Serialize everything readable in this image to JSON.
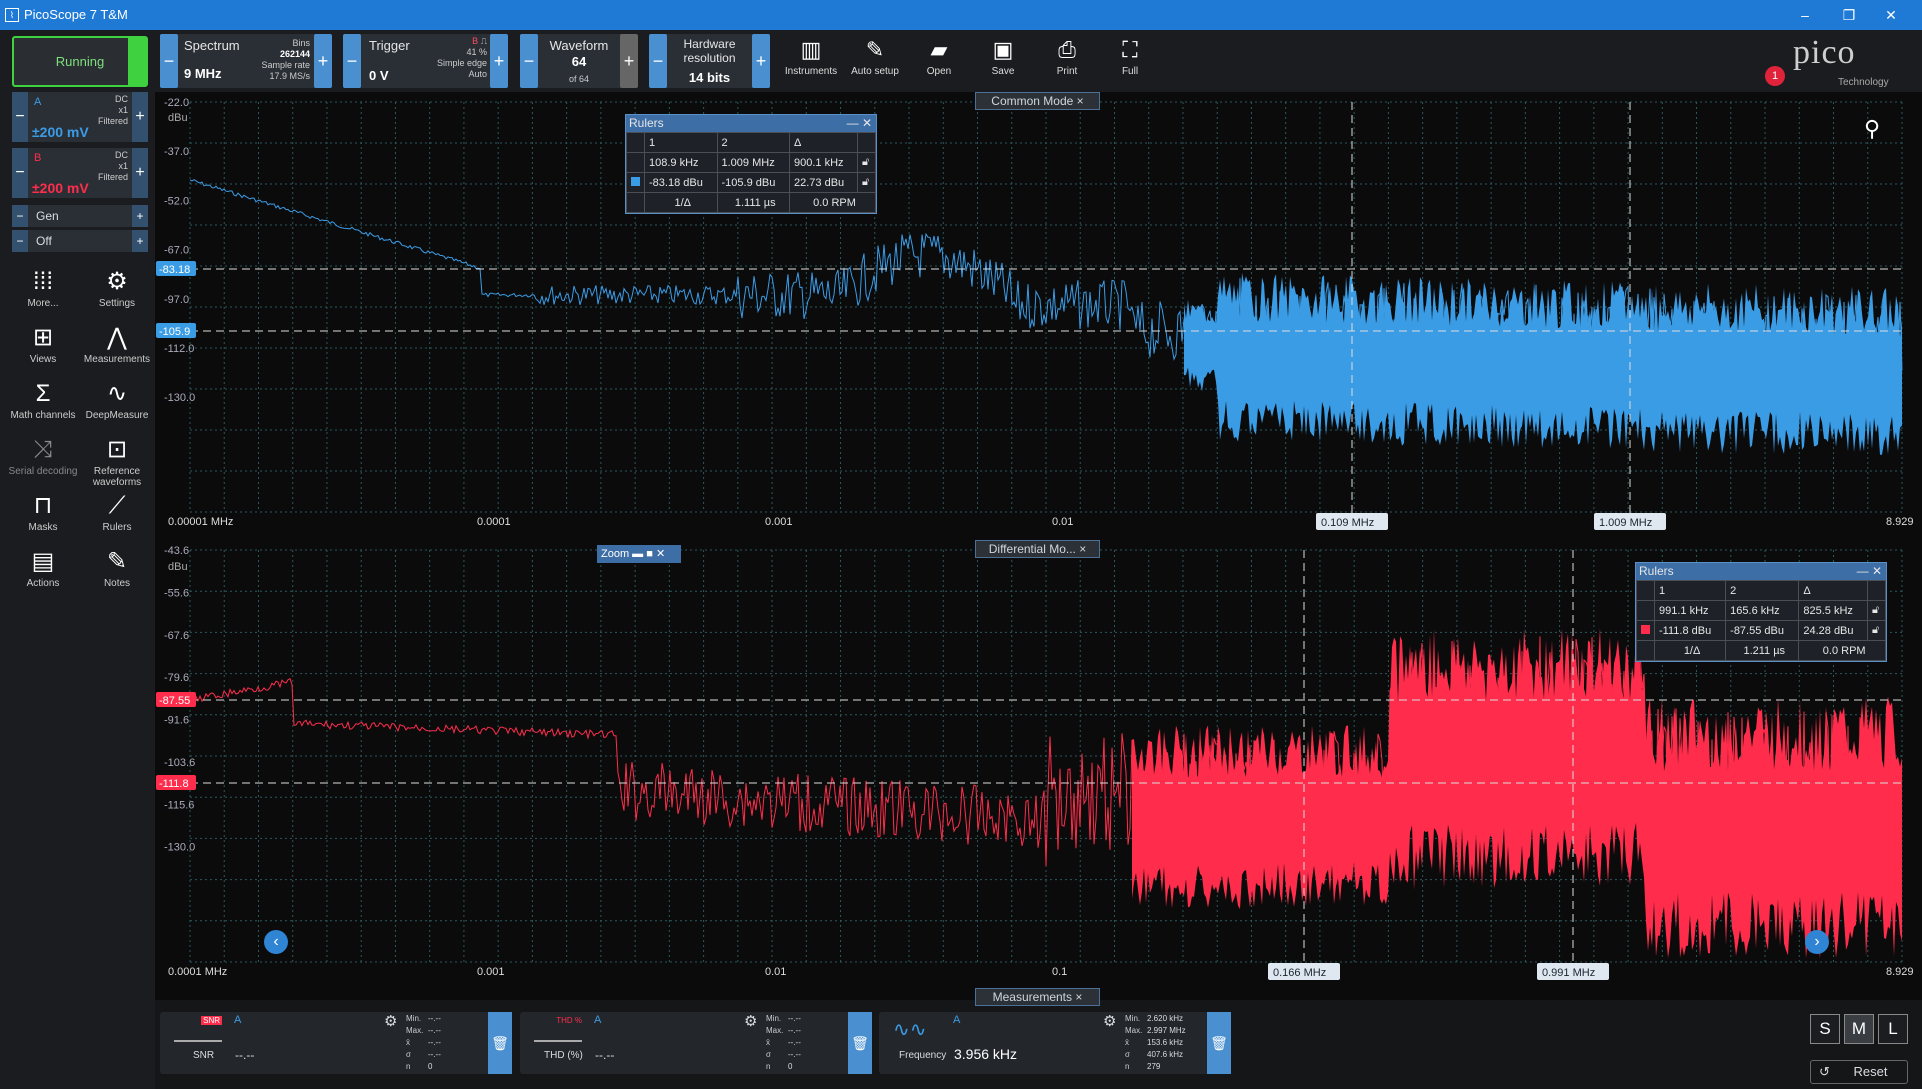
{
  "window": {
    "title": "PicoScope 7 T&M",
    "minimize": "–",
    "restore": "❐",
    "close": "✕"
  },
  "run": {
    "label": "Running"
  },
  "toolbar": {
    "spectrum": {
      "title": "Spectrum",
      "value": "9 MHz",
      "bins_label": "Bins",
      "bins": "262144",
      "rate_label": "Sample rate",
      "rate": "17.9 MS/s"
    },
    "trigger": {
      "title": "Trigger",
      "value": "0 V",
      "channel": "B",
      "percent": "41 %",
      "type": "Simple edge",
      "mode": "Auto"
    },
    "waveform": {
      "title": "Waveform",
      "value": "64",
      "of": "of 64"
    },
    "hardware": {
      "title": "Hardware resolution",
      "value": "14 bits"
    },
    "tools": [
      "Instruments",
      "Auto setup",
      "Open",
      "Save",
      "Print",
      "Full"
    ],
    "logo": "pico",
    "logo_sub": "Technology",
    "badge": "1"
  },
  "channels": [
    {
      "name": "A",
      "range": "±200 mV",
      "coupling": "DC",
      "probe": "x1",
      "filter": "Filtered",
      "color": "#3b9ce6"
    },
    {
      "name": "B",
      "range": "±200 mV",
      "coupling": "DC",
      "probe": "x1",
      "filter": "Filtered",
      "color": "#ff2d4b"
    }
  ],
  "gen": {
    "label": "Gen",
    "state": "Off"
  },
  "side_tools": [
    "More...",
    "Settings",
    "Views",
    "Measurements",
    "Math channels",
    "DeepMeasure",
    "Serial decoding",
    "Reference waveforms",
    "Masks",
    "Rulers",
    "Actions",
    "Notes"
  ],
  "view1": {
    "tab": "Common Mode",
    "close": "×",
    "unit": "dBu",
    "yticks": [
      "-22.0",
      "-37.0",
      "-52.0",
      "-67.0",
      "-97.0",
      "-112.0",
      "-130.0"
    ],
    "xticks": [
      "0.00001 MHz",
      "0.0001",
      "0.001",
      "0.01",
      "8.929"
    ],
    "ruler_y": [
      "-83.18",
      "-105.9"
    ],
    "ruler_x": [
      "0.109 MHz",
      "1.009 MHz"
    ],
    "rulers": {
      "title": "Rulers",
      "h1": "1",
      "h2": "2",
      "hd": "Δ",
      "r1": [
        "108.9 kHz",
        "1.009 MHz",
        "900.1 kHz"
      ],
      "r2": [
        "-83.18 dBu",
        "-105.9 dBu",
        "22.73 dBu"
      ],
      "inv": "1/Δ",
      "t": "1.111 µs",
      "rpm": "0.0 RPM"
    }
  },
  "view2": {
    "tab": "Differential Mo...",
    "close": "×",
    "unit": "dBu",
    "zoom": "Zoom",
    "yticks": [
      "-43.6",
      "-55.6",
      "-67.6",
      "-79.6",
      "-91.6",
      "-103.6",
      "-115.6",
      "-130.0"
    ],
    "xticks": [
      "0.0001 MHz",
      "0.001",
      "0.01",
      "0.1",
      "8.929"
    ],
    "ruler_y": [
      "-87.55",
      "-111.8"
    ],
    "ruler_x": [
      "0.166 MHz",
      "0.991 MHz"
    ],
    "rulers": {
      "title": "Rulers",
      "h1": "1",
      "h2": "2",
      "hd": "Δ",
      "r1": [
        "991.1 kHz",
        "165.6 kHz",
        "825.5 kHz"
      ],
      "r2": [
        "-111.8 dBu",
        "-87.55 dBu",
        "24.28 dBu"
      ],
      "inv": "1/Δ",
      "t": "1.211 µs",
      "rpm": "0.0 RPM"
    }
  },
  "measurements": {
    "tab": "Measurements",
    "items": [
      {
        "name": "SNR",
        "ch": "A",
        "value": "--.--",
        "min": "--.--",
        "max": "--.--",
        "mean": "--.--",
        "sd": "--.--",
        "n": "0"
      },
      {
        "name": "THD (%)",
        "ch": "A",
        "value": "--.--",
        "min": "--.--",
        "max": "--.--",
        "mean": "--.--",
        "sd": "--.--",
        "n": "0"
      },
      {
        "name": "Frequency",
        "ch": "A",
        "value": "3.956 kHz",
        "min": "2.620 kHz",
        "max": "2.997 MHz",
        "mean": "153.6 kHz",
        "sd": "407.6 kHz",
        "n": "279"
      }
    ],
    "stat_labels": [
      "Min.",
      "Max.",
      "x̄",
      "σ",
      "n"
    ]
  },
  "size": {
    "s": "S",
    "m": "M",
    "l": "L"
  },
  "reset": "Reset"
}
